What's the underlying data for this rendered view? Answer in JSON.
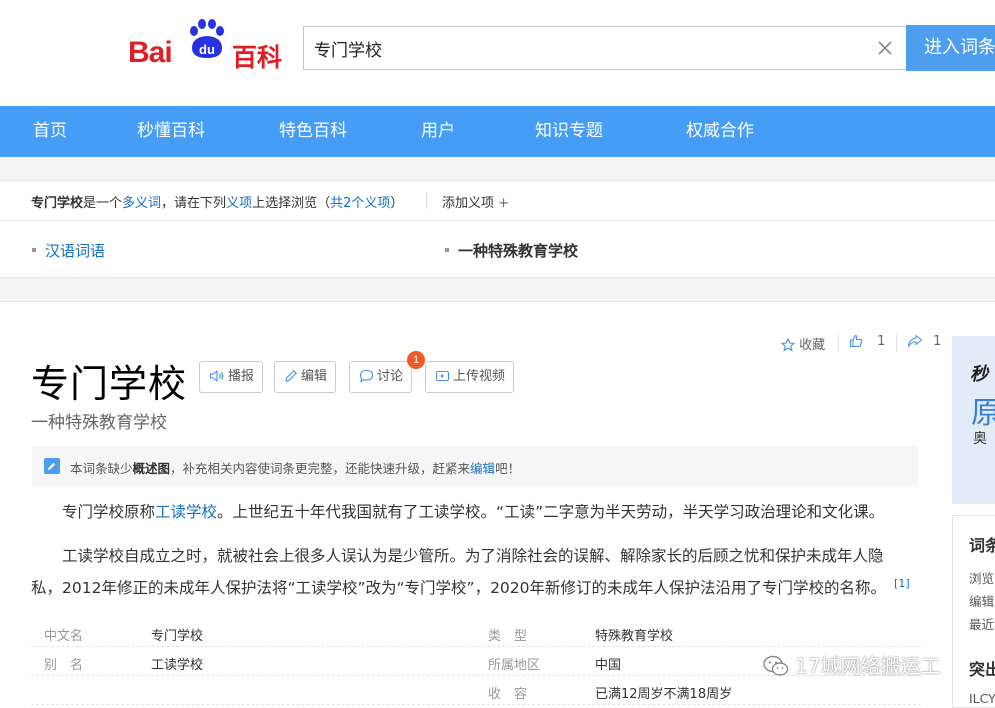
{
  "header": {
    "logo_bai": "Bai",
    "logo_du": "du",
    "logo_baike": "百科",
    "search_value": "专门学校",
    "search_button": "进入词条"
  },
  "nav": {
    "items": [
      "首页",
      "秒懂百科",
      "特色百科",
      "用户",
      "知识专题",
      "权威合作"
    ]
  },
  "polysemy": {
    "term": "专门学校",
    "text_1": "是一个",
    "link_1": "多义词",
    "text_2": "，请在下列",
    "link_2": "义项",
    "text_3": "上选择浏览（",
    "link_3": "共2个义项",
    "text_4": "）",
    "add_label": "添加义项",
    "add_icon": "+"
  },
  "senses": [
    "汉语词语",
    "一种特殊教育学校"
  ],
  "lemma": {
    "title": "专门学校",
    "subtitle": "一种特殊教育学校",
    "buttons": {
      "play": "播报",
      "edit": "编辑",
      "discuss": "讨论",
      "upload_video": "上传视频"
    },
    "discuss_badge": "1",
    "collect_label": "收藏",
    "like_count": "1",
    "share_count": "1"
  },
  "notice": {
    "t1": "本词条缺少",
    "b1": "概述图",
    "t2": "，补充相关内容使词条更完整，还能快速升级，赶紧来",
    "link": "编辑",
    "t3": "吧！"
  },
  "paragraphs": {
    "p1_a": "专门学校原称",
    "p1_link": "工读学校",
    "p1_b": "。上世纪五十年代我国就有了工读学校。“工读”二字意为半天劳动，半天学习政治理论和文化课。",
    "p2": "工读学校自成立之时，就被社会上很多人误认为是少管所。为了消除社会的误解、解除家长的后顾之忧和保护未成年人隐私，2012年修正的未成年人保护法将“工读学校”改为“专门学校”，2020年新修订的未成年人保护法沿用了专门学校的名称。",
    "p2_ref": "[1]"
  },
  "infobox": {
    "rows": [
      {
        "k1": "中文名",
        "v1": "专门学校",
        "k2": "类　型",
        "v2": "特殊教育学校"
      },
      {
        "k1": "别　名",
        "v1": "工读学校",
        "k2": "所属地区",
        "v2": "中国"
      },
      {
        "k1": "",
        "v1": "",
        "k2": "收　容",
        "v2": "已满12周岁不满18周岁"
      }
    ]
  },
  "side": {
    "top_a": "秒",
    "top_b": "原",
    "top_c": "奥",
    "card_title": "词条",
    "card_lines": [
      "浏览",
      "编辑",
      "最近"
    ],
    "card_title2": "突出",
    "card_line4": "ILCY"
  },
  "watermark": "17城网络搬运工"
}
